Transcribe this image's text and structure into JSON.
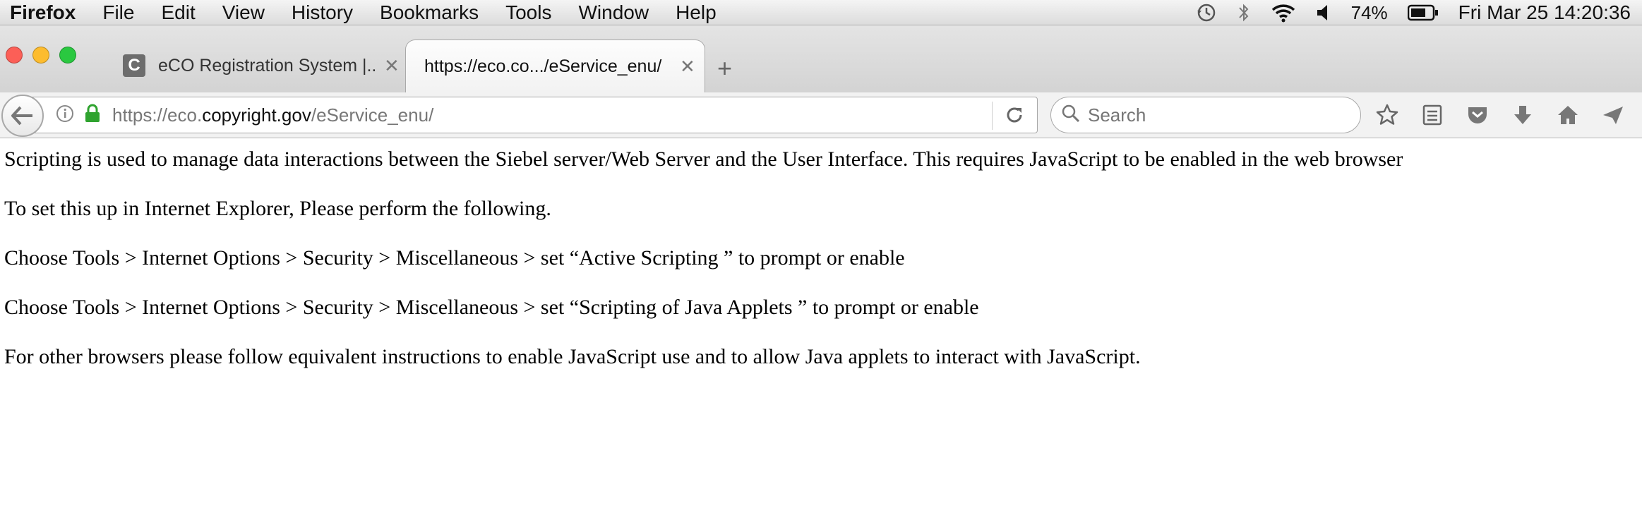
{
  "menubar": {
    "app_name": "Firefox",
    "items": [
      "File",
      "Edit",
      "View",
      "History",
      "Bookmarks",
      "Tools",
      "Window",
      "Help"
    ],
    "battery": "74%",
    "clock": "Fri Mar 25  14:20:36"
  },
  "tabs": [
    {
      "title": "eCO Registration System |...",
      "favicon": "C",
      "active": false
    },
    {
      "title": "https://eco.co.../eService_enu/",
      "active": true
    }
  ],
  "navbar": {
    "url_prefix": "https://eco.",
    "url_domain": "copyright.gov",
    "url_suffix": "/eService_enu/",
    "search_placeholder": "Search"
  },
  "content": {
    "paragraphs": [
      "Scripting is used to manage data interactions between the Siebel server/Web Server and the User Interface. This requires JavaScript to be enabled in the web browser",
      "To set this up in Internet Explorer, Please perform the following.",
      "Choose Tools > Internet Options > Security > Miscellaneous > set “Active Scripting ” to prompt or enable",
      "Choose Tools > Internet Options > Security > Miscellaneous > set “Scripting of Java Applets ” to prompt or enable",
      "For other browsers please follow equivalent instructions to enable JavaScript use and to allow Java applets to interact with JavaScript."
    ]
  },
  "icons": {
    "status": [
      "time-machine-icon",
      "bluetooth-icon",
      "wifi-icon",
      "volume-icon",
      "battery-icon"
    ],
    "toolbar": [
      "bookmark-star-icon",
      "reading-list-icon",
      "pocket-icon",
      "download-icon",
      "home-icon",
      "share-icon"
    ]
  },
  "colors": {
    "lock_green": "#2fa32f",
    "traffic_close": "#fc5f57",
    "traffic_min": "#fdbc2e",
    "traffic_max": "#2ac840"
  }
}
